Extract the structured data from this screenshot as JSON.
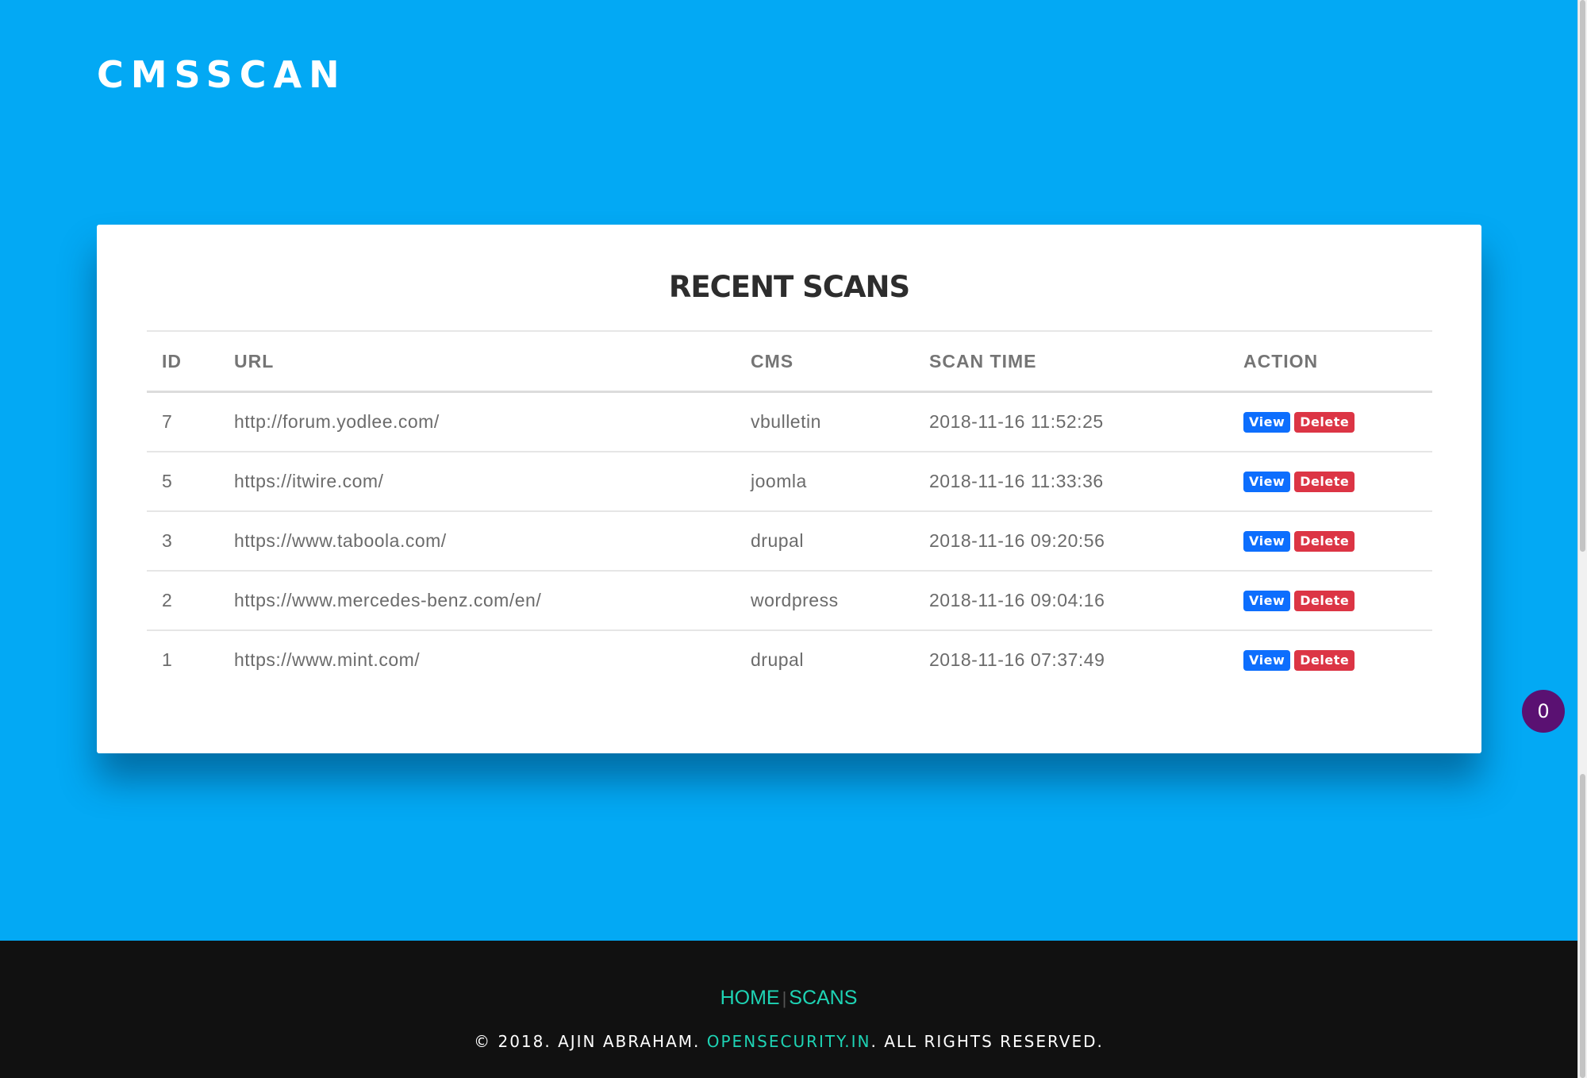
{
  "brand": {
    "logo_text": "CMSSCAN"
  },
  "card": {
    "title": "RECENT SCANS",
    "columns": {
      "id": "ID",
      "url": "URL",
      "cms": "CMS",
      "scan_time": "SCAN TIME",
      "action": "ACTION"
    },
    "rows": [
      {
        "id": "7",
        "url": "http://forum.yodlee.com/",
        "cms": "vbulletin",
        "scan_time": "2018-11-16 11:52:25",
        "view": "View",
        "delete": "Delete"
      },
      {
        "id": "5",
        "url": "https://itwire.com/",
        "cms": "joomla",
        "scan_time": "2018-11-16 11:33:36",
        "view": "View",
        "delete": "Delete"
      },
      {
        "id": "3",
        "url": "https://www.taboola.com/",
        "cms": "drupal",
        "scan_time": "2018-11-16 09:20:56",
        "view": "View",
        "delete": "Delete"
      },
      {
        "id": "2",
        "url": "https://www.mercedes-benz.com/en/",
        "cms": "wordpress",
        "scan_time": "2018-11-16 09:04:16",
        "view": "View",
        "delete": "Delete"
      },
      {
        "id": "1",
        "url": "https://www.mint.com/",
        "cms": "drupal",
        "scan_time": "2018-11-16 07:37:49",
        "view": "View",
        "delete": "Delete"
      }
    ]
  },
  "floating_badge": {
    "count": "0"
  },
  "footer": {
    "nav": {
      "home": "HOME",
      "separator": "|",
      "scans": "SCANS"
    },
    "copyright_prefix": "© 2018. AJIN ABRAHAM.",
    "copyright_link": "OPENSECURITY.IN",
    "copyright_suffix": ". ALL RIGHTS RESERVED."
  },
  "colors": {
    "hero_bg": "#03a9f4",
    "footer_bg": "#111111",
    "accent_link": "#1ed3b4",
    "view_button": "#0d6efd",
    "delete_button": "#dc3545",
    "badge_bg": "#5a1172"
  }
}
